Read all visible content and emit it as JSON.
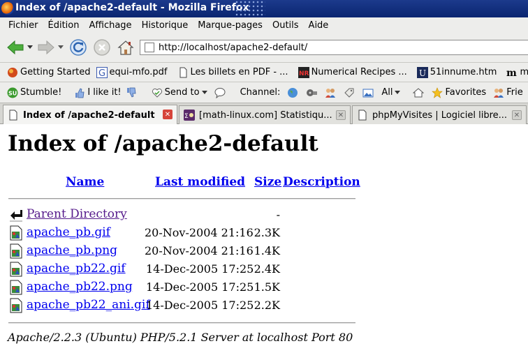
{
  "window": {
    "title": "Index of /apache2-default - Mozilla Firefox"
  },
  "menu": [
    "Fichier",
    "Édition",
    "Affichage",
    "Historique",
    "Marque-pages",
    "Outils",
    "Aide"
  ],
  "nav": {
    "url": "http://localhost/apache2-default/"
  },
  "bookmarks": [
    {
      "label": "Getting Started",
      "icon": "firefox-icon"
    },
    {
      "label": "equi-mfo.pdf",
      "icon": "g-icon"
    },
    {
      "label": "Les billets en PDF - ...",
      "icon": "document-icon"
    },
    {
      "label": "Numerical Recipes ...",
      "icon": "nr-icon"
    },
    {
      "label": "51innume.htm",
      "icon": "u-icon"
    },
    {
      "label": "me",
      "icon": "m-icon"
    }
  ],
  "stumble": {
    "stumble_label": "Stumble!",
    "like_label": "I like it!",
    "send_label": "Send to",
    "channel_label": "Channel:",
    "all_label": "All",
    "favorites_label": "Favorites",
    "friends_label": "Frie"
  },
  "tabs": [
    {
      "label": "Index of /apache2-default",
      "active": true
    },
    {
      "label": "[math-linux.com] Statistiqu...",
      "active": false
    },
    {
      "label": "phpMyVisites | Logiciel libre...",
      "active": false
    }
  ],
  "page": {
    "heading": "Index of /apache2-default",
    "headers": {
      "name": "Name",
      "modified": "Last modified",
      "size": "Size",
      "description": "Description"
    },
    "entries": [
      {
        "name": "Parent Directory",
        "date": "",
        "size": "-",
        "type": "parent"
      },
      {
        "name": "apache_pb.gif",
        "date": "20-Nov-2004 21:16",
        "size": "2.3K",
        "type": "image"
      },
      {
        "name": "apache_pb.png",
        "date": "20-Nov-2004 21:16",
        "size": "1.4K",
        "type": "image"
      },
      {
        "name": "apache_pb22.gif",
        "date": "14-Dec-2005 17:25",
        "size": "2.4K",
        "type": "image"
      },
      {
        "name": "apache_pb22.png",
        "date": "14-Dec-2005 17:25",
        "size": "1.5K",
        "type": "image"
      },
      {
        "name": "apache_pb22_ani.gif",
        "date": "14-Dec-2005 17:25",
        "size": "2.2K",
        "type": "image"
      }
    ],
    "address": "Apache/2.2.3 (Ubuntu) PHP/5.2.1 Server at localhost Port 80"
  }
}
